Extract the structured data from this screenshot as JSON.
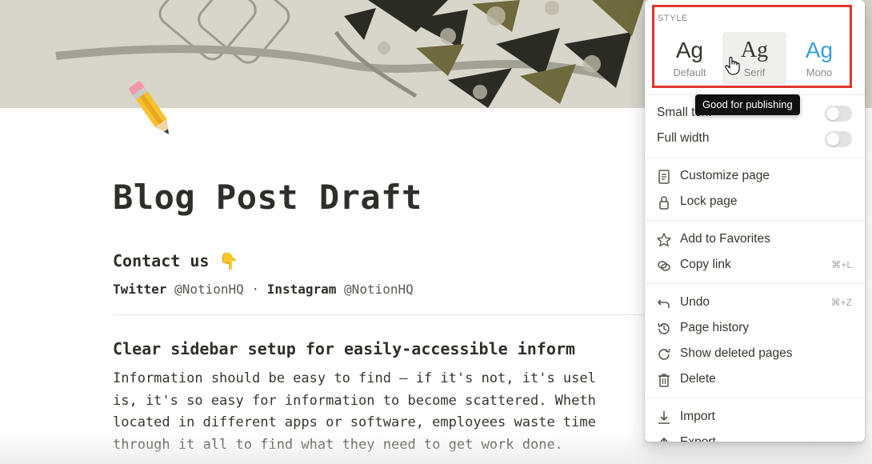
{
  "page": {
    "title": "Blog Post Draft",
    "icon": "pencil-icon",
    "contact_heading": "Contact us 👇",
    "social": {
      "twitter_label": "Twitter",
      "twitter_handle": "@NotionHQ",
      "separator": "·",
      "instagram_label": "Instagram",
      "instagram_handle": "@NotionHQ"
    },
    "section_heading": "Clear sidebar setup for easily-accessible inform",
    "paragraph_lines": [
      "Information should be easy to find — if it's not, it's usel",
      "is, it's so easy for information to become scattered. Wheth",
      "located in different apps or software, employees waste time",
      "through it all to find what they need to get work done."
    ]
  },
  "menu": {
    "style_label": "STYLE",
    "fonts": [
      {
        "sample": "Ag",
        "name": "Default",
        "selected": false
      },
      {
        "sample": "Ag",
        "name": "Serif",
        "selected": true
      },
      {
        "sample": "Ag",
        "name": "Mono",
        "selected": false
      }
    ],
    "tooltip": "Good for publishing",
    "toggles": [
      {
        "label": "Small text",
        "on": false
      },
      {
        "label": "Full width",
        "on": false
      }
    ],
    "group1": [
      {
        "label": "Customize page",
        "icon": "document-icon"
      },
      {
        "label": "Lock page",
        "icon": "lock-icon"
      }
    ],
    "group2": [
      {
        "label": "Add to Favorites",
        "icon": "star-icon",
        "shortcut": ""
      },
      {
        "label": "Copy link",
        "icon": "link-icon",
        "shortcut": "⌘+L"
      }
    ],
    "group3": [
      {
        "label": "Undo",
        "icon": "undo-icon",
        "shortcut": "⌘+Z"
      },
      {
        "label": "Page history",
        "icon": "history-icon",
        "shortcut": ""
      },
      {
        "label": "Show deleted pages",
        "icon": "restore-icon",
        "shortcut": ""
      },
      {
        "label": "Delete",
        "icon": "trash-icon",
        "shortcut": ""
      }
    ],
    "group4": [
      {
        "label": "Import",
        "icon": "import-icon"
      },
      {
        "label": "Export",
        "icon": "export-icon"
      }
    ]
  },
  "colors": {
    "highlight_border": "#e2342b",
    "mono_accent": "#3aa0d6",
    "tooltip_bg": "#111111"
  }
}
